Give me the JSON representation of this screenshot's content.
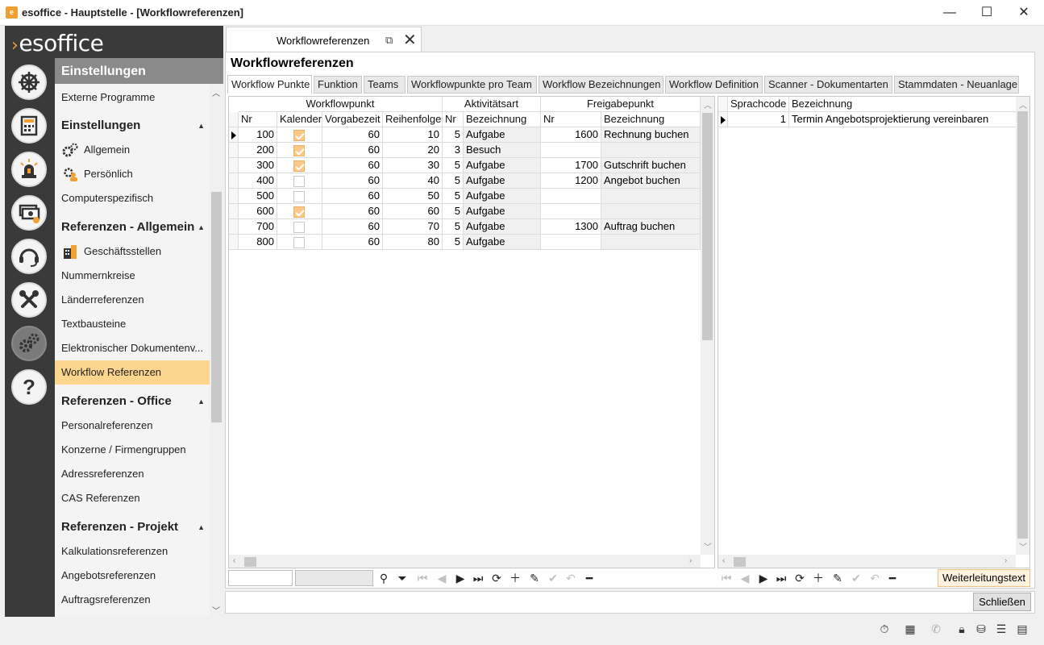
{
  "window": {
    "title": "esoffice - Hauptstelle - [Workflowreferenzen]",
    "minimize": "—",
    "maximize": "☐",
    "close": "✕"
  },
  "brand": {
    "name": "esoffice"
  },
  "nav": {
    "header": "Einstellungen",
    "items": [
      {
        "type": "item",
        "label": "Externe Programme"
      },
      {
        "type": "group",
        "label": "Einstellungen"
      },
      {
        "type": "item",
        "label": "Allgemein",
        "icon": "gears-icon"
      },
      {
        "type": "item",
        "label": "Persönlich",
        "icon": "user-gear-icon"
      },
      {
        "type": "item",
        "label": "Computerspezifisch"
      },
      {
        "type": "group",
        "label": "Referenzen - Allgemein"
      },
      {
        "type": "item",
        "label": "Geschäftsstellen",
        "icon": "building-icon"
      },
      {
        "type": "item",
        "label": "Nummernkreise"
      },
      {
        "type": "item",
        "label": "Länderreferenzen"
      },
      {
        "type": "item",
        "label": "Textbausteine"
      },
      {
        "type": "item",
        "label": "Elektronischer Dokumentenv..."
      },
      {
        "type": "item",
        "label": "Workflow Referenzen",
        "selected": true
      },
      {
        "type": "group",
        "label": "Referenzen - Office"
      },
      {
        "type": "item",
        "label": "Personalreferenzen"
      },
      {
        "type": "item",
        "label": "Konzerne / Firmengruppen"
      },
      {
        "type": "item",
        "label": "Adressreferenzen"
      },
      {
        "type": "item",
        "label": "CAS Referenzen"
      },
      {
        "type": "group",
        "label": "Referenzen - Projekt"
      },
      {
        "type": "item",
        "label": "Kalkulationsreferenzen"
      },
      {
        "type": "item",
        "label": "Angebotsreferenzen"
      },
      {
        "type": "item",
        "label": "Auftragsreferenzen"
      }
    ]
  },
  "doc_tab": {
    "label": "Workflowreferenzen"
  },
  "page": {
    "title": "Workflowreferenzen"
  },
  "tabs": [
    "Workflow Punkte",
    "Funktion",
    "Teams",
    "Workflowpunkte pro Team",
    "Workflow Bezeichnungen",
    "Workflow Definition",
    "Scanner - Dokumentarten",
    "Stammdaten - Neuanlage"
  ],
  "grid_left": {
    "group_headers": [
      "Workflowpunkt",
      "Aktivitätsart",
      "Freigabepunkt"
    ],
    "columns": [
      "Nr",
      "Kalender",
      "Vorgabezeit",
      "Reihenfolge",
      "Nr",
      "Bezeichnung",
      "Nr",
      "Bezeichnung"
    ],
    "rows": [
      {
        "nr": "100",
        "kalender": true,
        "vorgabe": "60",
        "reihe": "10",
        "anr": "5",
        "abez": "Aufgabe",
        "fnr": "1600",
        "fbez": "Rechnung buchen"
      },
      {
        "nr": "200",
        "kalender": true,
        "vorgabe": "60",
        "reihe": "20",
        "anr": "3",
        "abez": "Besuch",
        "fnr": "",
        "fbez": ""
      },
      {
        "nr": "300",
        "kalender": true,
        "vorgabe": "60",
        "reihe": "30",
        "anr": "5",
        "abez": "Aufgabe",
        "fnr": "1700",
        "fbez": "Gutschrift buchen"
      },
      {
        "nr": "400",
        "kalender": false,
        "vorgabe": "60",
        "reihe": "40",
        "anr": "5",
        "abez": "Aufgabe",
        "fnr": "1200",
        "fbez": "Angebot buchen"
      },
      {
        "nr": "500",
        "kalender": false,
        "vorgabe": "60",
        "reihe": "50",
        "anr": "5",
        "abez": "Aufgabe",
        "fnr": "",
        "fbez": ""
      },
      {
        "nr": "600",
        "kalender": true,
        "vorgabe": "60",
        "reihe": "60",
        "anr": "5",
        "abez": "Aufgabe",
        "fnr": "",
        "fbez": ""
      },
      {
        "nr": "700",
        "kalender": false,
        "vorgabe": "60",
        "reihe": "70",
        "anr": "5",
        "abez": "Aufgabe",
        "fnr": "1300",
        "fbez": "Auftrag buchen"
      },
      {
        "nr": "800",
        "kalender": false,
        "vorgabe": "60",
        "reihe": "80",
        "anr": "5",
        "abez": "Aufgabe",
        "fnr": "",
        "fbez": ""
      }
    ]
  },
  "grid_right": {
    "columns": [
      "Sprachcode",
      "Bezeichnung"
    ],
    "rows": [
      {
        "code": "1",
        "bez": "Termin Angebotsprojektierung vereinbaren"
      }
    ]
  },
  "toolbar": {
    "buttons": [
      "search-icon",
      "filter-icon",
      "first-icon",
      "prev-icon",
      "next-icon",
      "last-icon",
      "refresh-icon",
      "add-icon",
      "edit-icon",
      "confirm-icon",
      "undo-icon",
      "delete-icon"
    ],
    "weiterleitung": "Weiterleitungstext"
  },
  "footer": {
    "close_label": "Schließen"
  },
  "colors": {
    "accent": "#f0a030",
    "selected_nav": "#fcd68e",
    "dark_rail": "#3a3a3a",
    "check_on": "#fbc98a"
  }
}
